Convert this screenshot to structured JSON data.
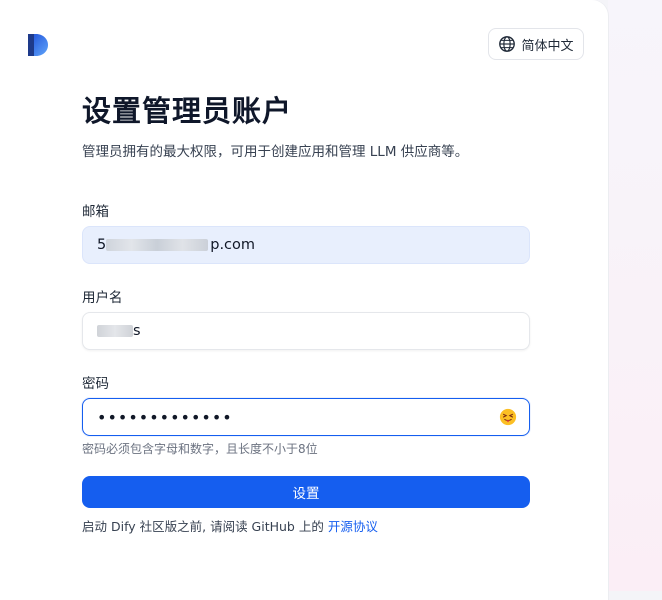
{
  "language_button": {
    "label": "简体中文",
    "icon": "globe-icon"
  },
  "header": {
    "title": "设置管理员账户",
    "subtitle": "管理员拥有的最大权限，可用于创建应用和管理 LLM 供应商等。"
  },
  "form": {
    "email": {
      "label": "邮箱",
      "value_visible_start": "5",
      "value_visible_end": "p.com"
    },
    "username": {
      "label": "用户名",
      "value_visible_end": "s"
    },
    "password": {
      "label": "密码",
      "value_masked": "•••••••••••••",
      "toggle_icon": "eye-emoji-icon"
    },
    "password_hint": "密码必须包含字母和数字，且长度不小于8位",
    "submit_label": "设置"
  },
  "footer": {
    "text": "启动 Dify 社区版之前, 请阅读 GitHub 上的",
    "link_label": "开源协议"
  },
  "colors": {
    "accent": "#155eef",
    "title": "#0f172a",
    "email_field_bg": "#e8effd"
  }
}
